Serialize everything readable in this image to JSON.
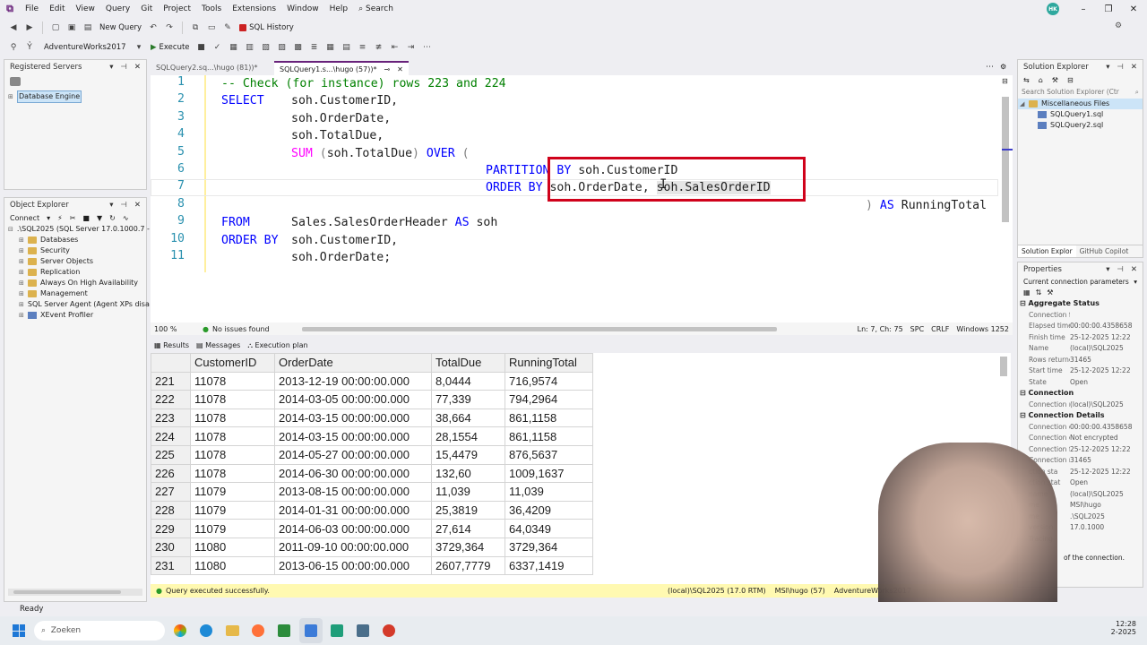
{
  "menu": {
    "items": [
      "File",
      "Edit",
      "View",
      "Query",
      "Git",
      "Project",
      "Tools",
      "Extensions",
      "Window",
      "Help"
    ],
    "search": "Search",
    "avatar_initials": "HK"
  },
  "toolbar1": {
    "new_query": "New Query",
    "sql_history": "SQL History"
  },
  "toolbar2": {
    "database": "AdventureWorks2017",
    "execute": "Execute"
  },
  "registered_servers": {
    "title": "Registered Servers",
    "item": "Database Engine"
  },
  "object_explorer": {
    "title": "Object Explorer",
    "connect": "Connect",
    "server": ".\\SQL2025 (SQL Server 17.0.1000.7 - M",
    "items": [
      "Databases",
      "Security",
      "Server Objects",
      "Replication",
      "Always On High Availability",
      "Management",
      "SQL Server Agent (Agent XPs disa",
      "XEvent Profiler"
    ]
  },
  "tabs": [
    {
      "label": "SQLQuery2.sq...\\hugo (81))*"
    },
    {
      "label": "SQLQuery1.s...\\hugo (57))*"
    }
  ],
  "code": {
    "lines": [
      {
        "n": "1"
      },
      {
        "n": "2"
      },
      {
        "n": "3"
      },
      {
        "n": "4"
      },
      {
        "n": "5"
      },
      {
        "n": "6"
      },
      {
        "n": "7"
      },
      {
        "n": "8"
      },
      {
        "n": "9"
      },
      {
        "n": "10"
      },
      {
        "n": "11"
      }
    ],
    "l1": "-- Check (for instance) rows 223 and 224",
    "l2_kw": "SELECT",
    "l2_rest": "soh.CustomerID,",
    "l3": "soh.OrderDate,",
    "l4": "soh.TotalDue,",
    "l5_fn": "SUM",
    "l5_paren": "(",
    "l5_rest": "soh.TotalDue",
    "l5_close": ")",
    "l5_kw": "OVER",
    "l5_open": "(",
    "l6_kw": "PARTITION BY",
    "l6_rest": "soh.CustomerID",
    "l7_kw": "ORDER BY",
    "l7_rest1": "soh.OrderDate,",
    "l7_rest2": "soh.SalesOrderID",
    "l8_paren": ")",
    "l8_kw": "AS",
    "l8_rest": "RunningTotal",
    "l9_kw": "FROM",
    "l9_rest": "Sales.SalesOrderHeader",
    "l9_kw2": "AS",
    "l9_rest2": "soh",
    "l10_kw": "ORDER BY",
    "l10_rest": "soh.CustomerID,",
    "l11": "soh.OrderDate;"
  },
  "editor_status": {
    "zoom": "100 %",
    "issues": "No issues found",
    "position": "Ln: 7, Ch: 75",
    "spc": "SPC",
    "crlf": "CRLF",
    "encoding": "Windows 1252"
  },
  "result_tabs": [
    "Results",
    "Messages",
    "Execution plan"
  ],
  "results": {
    "columns": [
      "CustomerID",
      "OrderDate",
      "TotalDue",
      "RunningTotal"
    ],
    "rows": [
      [
        "221",
        "11078",
        "2013-12-19 00:00:00.000",
        "8,0444",
        "716,9574"
      ],
      [
        "222",
        "11078",
        "2014-03-05 00:00:00.000",
        "77,339",
        "794,2964"
      ],
      [
        "223",
        "11078",
        "2014-03-15 00:00:00.000",
        "38,664",
        "861,1158"
      ],
      [
        "224",
        "11078",
        "2014-03-15 00:00:00.000",
        "28,1554",
        "861,1158"
      ],
      [
        "225",
        "11078",
        "2014-05-27 00:00:00.000",
        "15,4479",
        "876,5637"
      ],
      [
        "226",
        "11078",
        "2014-06-30 00:00:00.000",
        "132,60",
        "1009,1637"
      ],
      [
        "227",
        "11079",
        "2013-08-15 00:00:00.000",
        "11,039",
        "11,039"
      ],
      [
        "228",
        "11079",
        "2014-01-31 00:00:00.000",
        "25,3819",
        "36,4209"
      ],
      [
        "229",
        "11079",
        "2014-06-03 00:00:00.000",
        "27,614",
        "64,0349"
      ],
      [
        "230",
        "11080",
        "2011-09-10 00:00:00.000",
        "3729,364",
        "3729,364"
      ],
      [
        "231",
        "11080",
        "2013-06-15 00:00:00.000",
        "2607,7779",
        "6337,1419"
      ]
    ]
  },
  "status": {
    "message": "Query executed successfully.",
    "server": "(local)\\SQL2025 (17.0 RTM)",
    "user": "MSI\\hugo (57)",
    "db": "AdventureWorks2017"
  },
  "ready": "Ready",
  "solution_explorer": {
    "title": "Solution Explorer",
    "search_placeholder": "Search Solution Explorer (Ctr",
    "folder": "Miscellaneous Files",
    "files": [
      "SQLQuery1.sql",
      "SQLQuery2.sql"
    ],
    "bottom_tabs": [
      "Solution Explor",
      "GitHub Copilot"
    ]
  },
  "properties": {
    "title": "Properties",
    "subject": "Current connection parameters",
    "cat1": "Aggregate Status",
    "agg": [
      [
        "Connection fail",
        ""
      ],
      [
        "Elapsed time",
        "00:00:00.4358658"
      ],
      [
        "Finish time",
        "25-12-2025 12:22"
      ],
      [
        "Name",
        "(local)\\SQL2025"
      ],
      [
        "Rows returned",
        "31465"
      ],
      [
        "Start time",
        "25-12-2025 12:22"
      ],
      [
        "State",
        "Open"
      ]
    ],
    "cat2": "Connection",
    "conn": [
      [
        "Connection nar",
        "(local)\\SQL2025"
      ]
    ],
    "cat3": "Connection Details",
    "details": [
      [
        "Connection ela",
        "00:00:00.4358658"
      ],
      [
        "Connection enc",
        "Not encrypted"
      ],
      [
        "Connection fini",
        "25-12-2025 12:22"
      ],
      [
        "Connection row",
        "31465"
      ],
      [
        "ction sta",
        "25-12-2025 12:22"
      ],
      [
        "ction stat",
        "Open"
      ],
      [
        "name",
        "(local)\\SQL2025"
      ],
      [
        "me",
        "MSI\\hugo"
      ],
      [
        "me",
        ".\\SQL2025"
      ],
      [
        "version",
        "17.0.1000"
      ],
      [
        "Tracing",
        ""
      ]
    ],
    "footer": "of the connection."
  },
  "taskbar": {
    "search": "Zoeken",
    "time": "12:28",
    "date": "2-2025"
  }
}
